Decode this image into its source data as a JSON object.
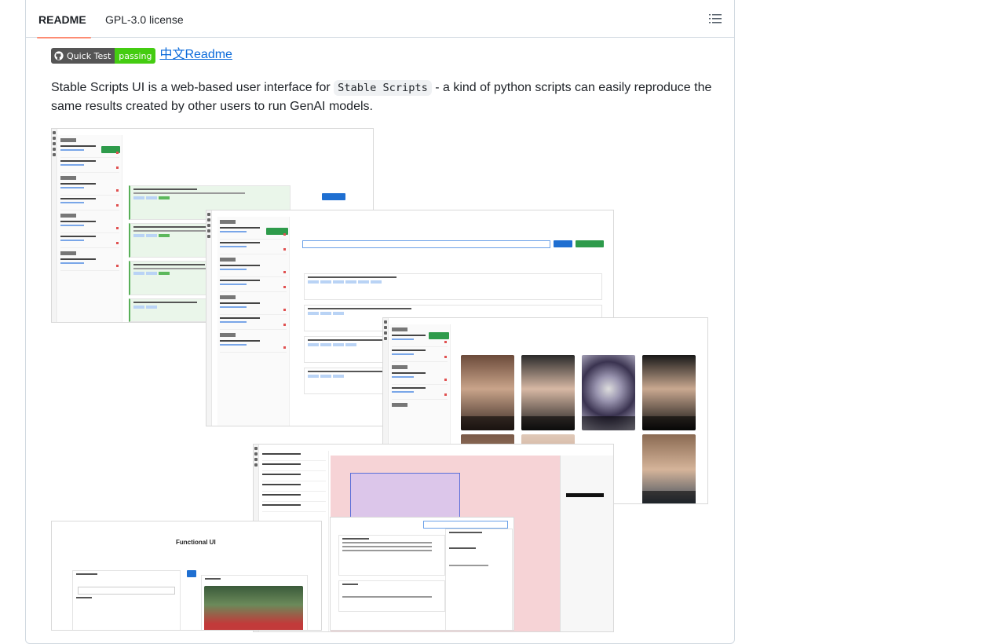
{
  "tabs": {
    "readme": "README",
    "license": "GPL-3.0 license"
  },
  "badge": {
    "label": "Quick Test",
    "status": "passing",
    "label_color": "#555555",
    "status_color": "#44cc11"
  },
  "chinese_readme_link": "中文Readme",
  "description": {
    "before": "Stable Scripts UI is a web-based user interface for ",
    "code": "Stable Scripts",
    "after": " - a kind of python scripts can easily reproduce the same results created by other users to run GenAI models."
  },
  "screenshot": {
    "functional_ui_title": "Functional UI"
  },
  "icons": {
    "outline": "list-unordered-icon",
    "github": "github-icon"
  },
  "colors": {
    "active_tab_underline": "#fd8c73",
    "link": "#0969da",
    "border": "#d1d9e0"
  }
}
